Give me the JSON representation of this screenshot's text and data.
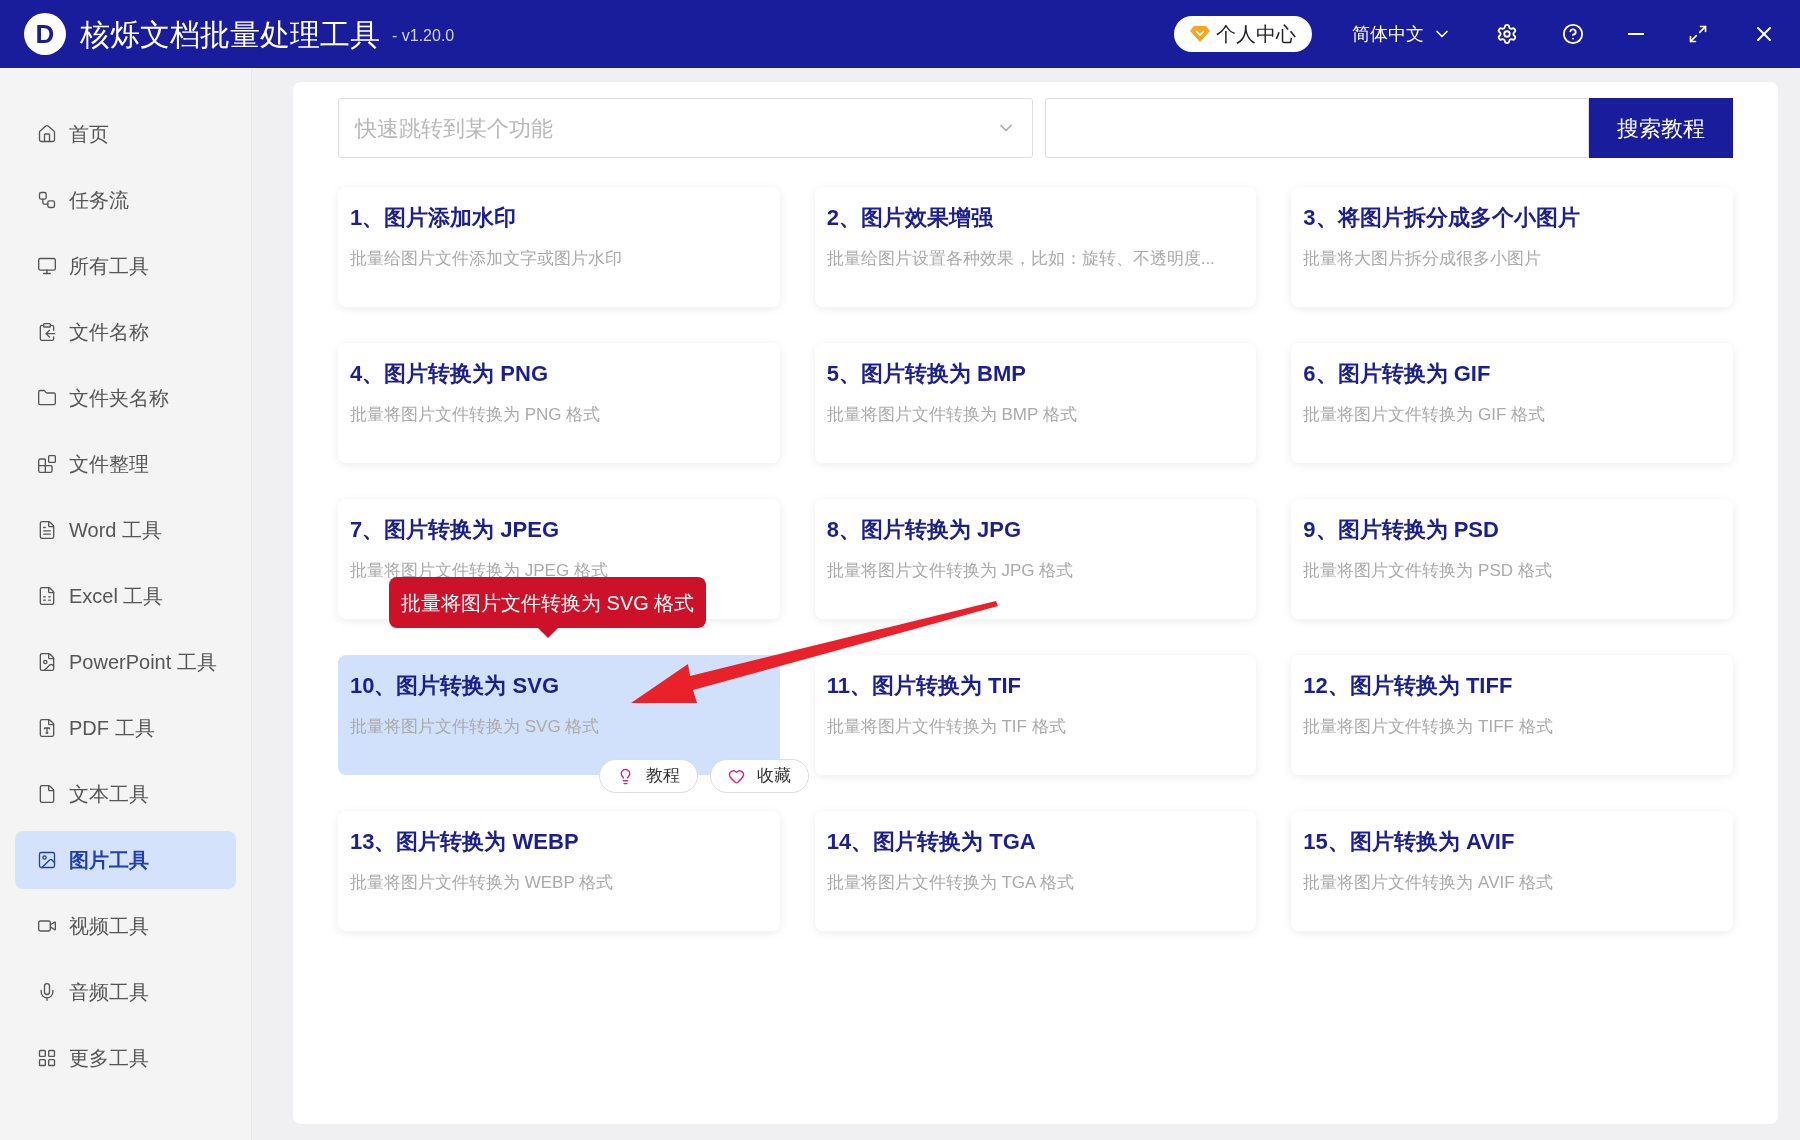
{
  "window": {
    "title": "核烁文档批量处理工具",
    "version": "- v1.20.0",
    "logo": "D"
  },
  "title_bar": {
    "account_button": "个人中心",
    "language": "简体中文"
  },
  "sidebar": {
    "items": [
      {
        "label": "首页",
        "selected": false
      },
      {
        "label": "任务流",
        "selected": false
      },
      {
        "label": "所有工具",
        "selected": false
      },
      {
        "label": "文件名称",
        "selected": false
      },
      {
        "label": "文件夹名称",
        "selected": false
      },
      {
        "label": "文件整理",
        "selected": false
      },
      {
        "label": "Word 工具",
        "selected": false
      },
      {
        "label": "Excel 工具",
        "selected": false
      },
      {
        "label": "PowerPoint 工具",
        "selected": false
      },
      {
        "label": "PDF 工具",
        "selected": false
      },
      {
        "label": "文本工具",
        "selected": false
      },
      {
        "label": "图片工具",
        "selected": true
      },
      {
        "label": "视频工具",
        "selected": false
      },
      {
        "label": "音频工具",
        "selected": false
      },
      {
        "label": "更多工具",
        "selected": false
      }
    ]
  },
  "toolbar": {
    "jump_select": {
      "placeholder": "快速跳转到某个功能"
    },
    "search_button": "搜索教程"
  },
  "cards": [
    {
      "title": "1、图片添加水印",
      "description": "批量给图片文件添加文字或图片水印",
      "selected": false
    },
    {
      "title": "2、图片效果增强",
      "description": "批量给图片设置各种效果，比如：旋转、不透明度...",
      "selected": false
    },
    {
      "title": "3、将图片拆分成多个小图片",
      "description": "批量将大图片拆分成很多小图片",
      "selected": false
    },
    {
      "title": "4、图片转换为 PNG",
      "description": "批量将图片文件转换为 PNG 格式",
      "selected": false
    },
    {
      "title": "5、图片转换为 BMP",
      "description": "批量将图片文件转换为 BMP 格式",
      "selected": false
    },
    {
      "title": "6、图片转换为 GIF",
      "description": "批量将图片文件转换为 GIF 格式",
      "selected": false
    },
    {
      "title": "7、图片转换为 JPEG",
      "description": "批量将图片文件转换为 JPEG 格式",
      "selected": false
    },
    {
      "title": "8、图片转换为 JPG",
      "description": "批量将图片文件转换为 JPG 格式",
      "selected": false
    },
    {
      "title": "9、图片转换为 PSD",
      "description": "批量将图片文件转换为 PSD 格式",
      "selected": false
    },
    {
      "title": "10、图片转换为 SVG",
      "description": "批量将图片文件转换为 SVG 格式",
      "selected": true,
      "tooltip": "批量将图片文件转换为 SVG 格式",
      "actions": [
        "教程",
        "收藏"
      ]
    },
    {
      "title": "11、图片转换为 TIF",
      "description": "批量将图片文件转换为 TIF 格式",
      "selected": false
    },
    {
      "title": "12、图片转换为 TIFF",
      "description": "批量将图片文件转换为 TIFF 格式",
      "selected": false
    },
    {
      "title": "13、图片转换为 WEBP",
      "description": "批量将图片文件转换为 WEBP 格式",
      "selected": false
    },
    {
      "title": "14、图片转换为 TGA",
      "description": "批量将图片文件转换为 TGA 格式",
      "selected": false
    },
    {
      "title": "15、图片转换为 AVIF",
      "description": "批量将图片文件转换为 AVIF 格式",
      "selected": false
    }
  ]
}
